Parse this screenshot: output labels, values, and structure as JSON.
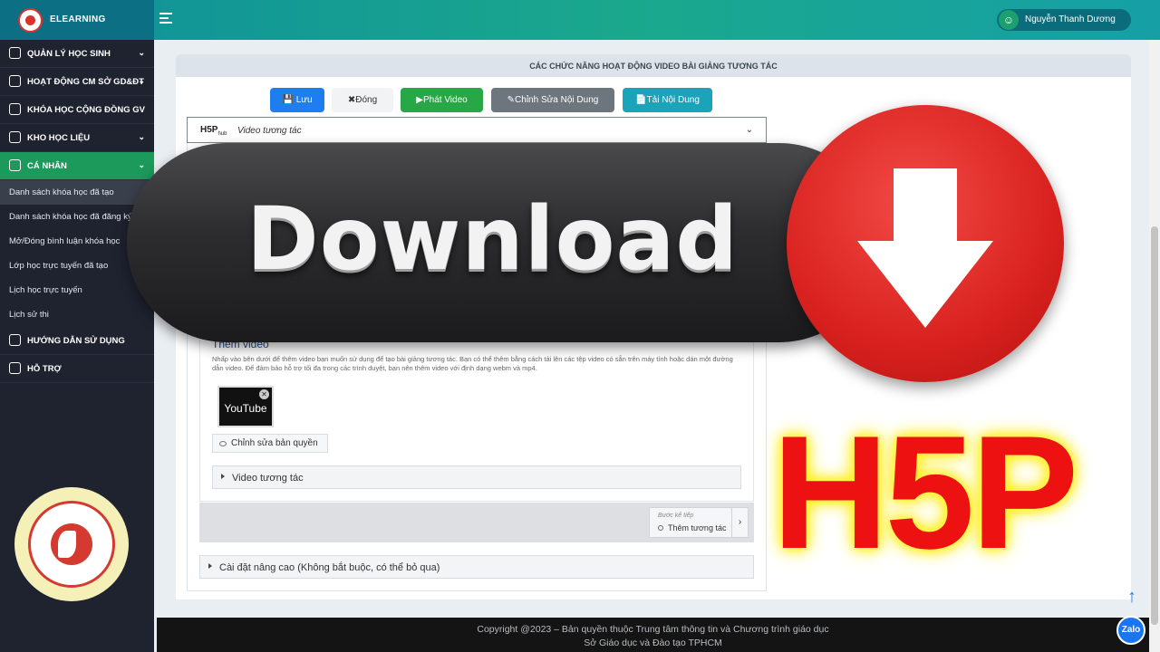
{
  "app": {
    "brand": "ELEARNING",
    "user_name": "Nguyễn Thanh Dương"
  },
  "sidebar": {
    "menu": [
      {
        "label": "QUẢN LÝ HỌC SINH"
      },
      {
        "label": "HOẠT ĐỘNG CM SỞ GD&ĐT"
      },
      {
        "label": "KHÓA HỌC CỘNG ĐỒNG GV"
      },
      {
        "label": "KHO HỌC LIỆU"
      },
      {
        "label": "CÁ NHÂN"
      }
    ],
    "sub_items": [
      "Danh sách khóa học đã tạo",
      "Danh sách khóa học đã đăng ký",
      "Mở/Đóng bình luận khóa học",
      "Lớp học trực tuyến đã tạo",
      "Lịch học trực tuyến",
      "Lịch sử thi"
    ],
    "bottom_menu": [
      {
        "label": "HƯỚNG DẪN SỬ DỤNG"
      },
      {
        "label": "HỖ TRỢ"
      }
    ]
  },
  "panel": {
    "title": "CÁC CHỨC NĂNG HOẠT ĐỘNG VIDEO BÀI GIẢNG TƯƠNG TÁC",
    "buttons": {
      "save": "Lưu",
      "close": "Đóng",
      "play": "Phát Video",
      "edit": "Chỉnh Sửa Nội Dung",
      "upload": "Tải Nội Dung"
    }
  },
  "h5p": {
    "logo": "H5P",
    "logo_sub": "hub",
    "content_type": "Video tương tác",
    "section_title": "Thêm video",
    "section_desc": "Nhấp vào bên dưới để thêm video bạn muốn sử dụng để tạo bài giảng tương tác. Bạn có thể thêm bằng cách tải lên các tệp video có sẵn trên máy tính hoặc dán một đường dẫn video. Để đảm bảo hỗ trợ tối đa trong các trình duyệt, bạn nên thêm video với định dạng webm và mp4.",
    "thumbnail_label": "YouTube",
    "copyright_button": "Chỉnh sửa bản quyền",
    "accordion_interactions": "Video tương tác",
    "next_step_caption": "Bước kế tiếp",
    "next_step_label": "Thêm tương tác",
    "advanced_settings": "Cài đặt nâng cao (Không bắt buộc, có thể bỏ qua)"
  },
  "footer": {
    "line1": "Copyright @2023 – Bản quyền thuộc Trung tâm thông tin và Chương trình giáo dục",
    "line2": "Sở Giáo dục và Đào tạo TPHCM"
  },
  "overlay": {
    "download_text": "Download",
    "h5p_text": "H5P"
  },
  "widgets": {
    "zalo": "Zalo"
  },
  "colors": {
    "topbar": "#1aa88d",
    "sidebar": "#1f2330",
    "active_menu": "#1c9a5c",
    "save": "#1e7ef0",
    "play": "#27a745",
    "edit": "#6d757d",
    "upload": "#1ba3ba",
    "download_red": "#d9221f",
    "h5p_red": "#ee1111"
  },
  "icons": {
    "menu": "hamburger-icon",
    "user": "user-icon",
    "collapse": "chevron-down-icon",
    "download": "download-arrow-icon",
    "scroll_top": "arrow-up-icon"
  }
}
